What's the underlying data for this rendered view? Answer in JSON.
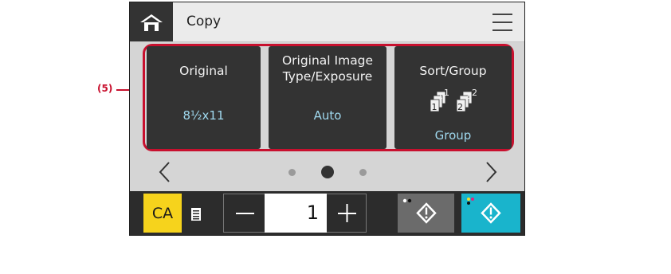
{
  "callout": {
    "label": "(5)"
  },
  "header": {
    "title": "Copy"
  },
  "tiles": [
    {
      "title_line1": "Original",
      "title_line2": "",
      "value": "8½x11"
    },
    {
      "title_line1": "Original Image",
      "title_line2": "Type/Exposure",
      "value": "Auto"
    },
    {
      "title_line1": "Sort/Group",
      "title_line2": "",
      "value": "Group"
    }
  ],
  "pager": {
    "pages": 3,
    "current": 2
  },
  "bottom": {
    "ca_label": "CA",
    "count": "1"
  },
  "colors": {
    "accent_red": "#c8102e",
    "value_blue": "#9fd8ee",
    "ca_yellow": "#f6d31c",
    "start_color": "#19b4cc"
  },
  "icons": [
    "home-icon",
    "menu-icon",
    "sort-group-icon",
    "chevron-left-icon",
    "chevron-right-icon",
    "job-status-icon",
    "minus-icon",
    "plus-icon",
    "start-icon"
  ]
}
